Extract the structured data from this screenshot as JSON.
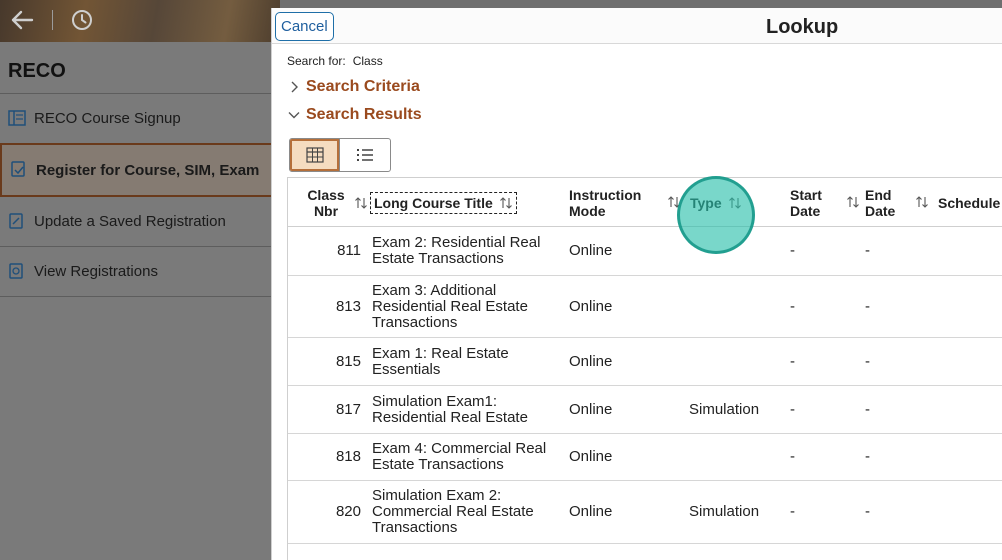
{
  "background": {
    "app_title": "RECO",
    "nav_items": [
      {
        "label": "RECO Course Signup",
        "active": false
      },
      {
        "label": "Register for Course, SIM, Exam",
        "active": true
      },
      {
        "label": "Update a Saved Registration",
        "active": false
      },
      {
        "label": "View Registrations",
        "active": false
      }
    ]
  },
  "modal": {
    "cancel_label": "Cancel",
    "title": "Lookup",
    "search_for_label": "Search for:",
    "search_for_value": "Class",
    "sections": {
      "criteria": "Search Criteria",
      "results": "Search Results"
    },
    "view_toggle": {
      "grid_icon": "grid-view-icon",
      "list_icon": "list-view-icon",
      "selected": "grid"
    }
  },
  "table": {
    "headers": {
      "class_nbr": "Class Nbr",
      "long_title": "Long Course Title",
      "instruction_mode": "Instruction Mode",
      "type": "Type",
      "start_date": "Start Date",
      "end_date": "End Date",
      "schedule": "Schedule"
    },
    "rows": [
      {
        "nbr": "811",
        "title": "Exam 2: Residential Real Estate Transactions",
        "mode": "Online",
        "type": "",
        "start": "-",
        "end": "-"
      },
      {
        "nbr": "813",
        "title": "Exam 3: Additional Residential Real Estate Transactions",
        "mode": "Online",
        "type": "",
        "start": "-",
        "end": "-"
      },
      {
        "nbr": "815",
        "title": "Exam 1: Real Estate Essentials",
        "mode": "Online",
        "type": "",
        "start": "-",
        "end": "-"
      },
      {
        "nbr": "817",
        "title": "Simulation Exam1: Residential Real Estate",
        "mode": "Online",
        "type": "Simulation",
        "start": "-",
        "end": "-"
      },
      {
        "nbr": "818",
        "title": "Exam 4: Commercial Real Estate Transactions",
        "mode": "Online",
        "type": "",
        "start": "-",
        "end": "-"
      },
      {
        "nbr": "820",
        "title": "Simulation Exam 2: Commercial Real Estate Transactions",
        "mode": "Online",
        "type": "Simulation",
        "start": "-",
        "end": "-"
      }
    ]
  },
  "colors": {
    "section_heading": "#9a4a1e",
    "cancel_border": "#1f6fa8",
    "toggle_selected": "#f5dcc0",
    "click_ring": "#26beaa"
  }
}
